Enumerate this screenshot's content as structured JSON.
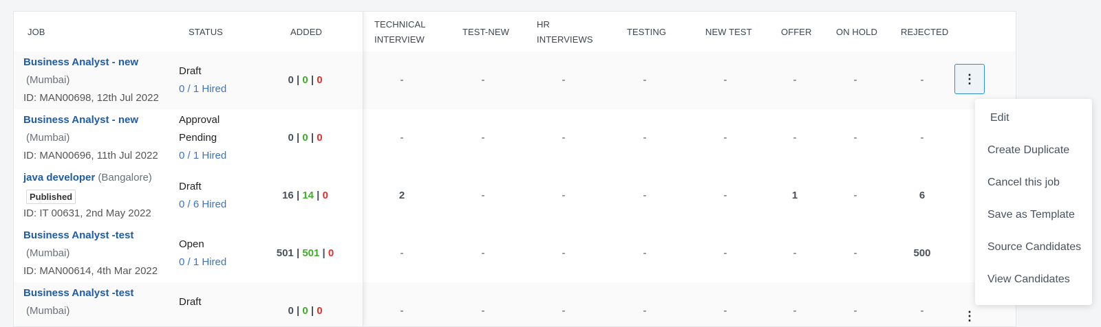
{
  "columns": [
    "Job",
    "Status",
    "Added",
    "Technical Interview",
    "Test-new",
    "HR Interviews",
    "Testing",
    "New Test",
    "Offer",
    "On Hold",
    "Rejected"
  ],
  "rows": [
    {
      "title": "Business Analyst - new",
      "location": "(Mumbai)",
      "id": "ID: MAN00698, 12th Jul 2022",
      "status": "Draft",
      "hired": "0 / 1 Hired",
      "added": {
        "a": "0",
        "b": "0",
        "c": "0"
      },
      "stages": [
        "-",
        "-",
        "-",
        "-",
        "-",
        "-",
        "-",
        "-"
      ]
    },
    {
      "title": "Business Analyst - new",
      "location": "(Mumbai)",
      "id": "ID: MAN00696, 11th Jul 2022",
      "status_line1": "Approval",
      "status_line2": "Pending",
      "hired": "0 / 1 Hired",
      "added": {
        "a": "0",
        "b": "0",
        "c": "0"
      },
      "stages": [
        "-",
        "-",
        "-",
        "-",
        "-",
        "-",
        "-",
        "-"
      ]
    },
    {
      "title": "java developer",
      "location": "(Bangalore)",
      "badge": "Published",
      "id": "ID: IT 00631, 2nd May 2022",
      "status": "Draft",
      "hired": "0 / 6 Hired",
      "added": {
        "a": "16",
        "b": "14",
        "c": "0"
      },
      "stages": [
        "2",
        "-",
        "-",
        "-",
        "-",
        "1",
        "-",
        "6"
      ]
    },
    {
      "title": "Business Analyst -test",
      "location": "(Mumbai)",
      "id": "ID: MAN00614, 4th Mar 2022",
      "status": "Open",
      "hired": "0 / 1 Hired",
      "added": {
        "a": "501",
        "b": "501",
        "c": "0"
      },
      "stages": [
        "-",
        "-",
        "-",
        "-",
        "-",
        "-",
        "-",
        "500"
      ]
    },
    {
      "title": "Business Analyst -test",
      "location": "(Mumbai)",
      "status": "Draft",
      "added": {
        "a": "0",
        "b": "0",
        "c": "0"
      },
      "stages": [
        "-",
        "-",
        "-",
        "-",
        "-",
        "-",
        "-",
        "-"
      ]
    }
  ],
  "actions_menu": [
    "Edit",
    "Create Duplicate",
    "Cancel this job",
    "Save as Template",
    "Source Candidates",
    "View Candidates"
  ],
  "icons": {
    "row_actions": "more-vertical-icon"
  },
  "colors": {
    "link": "#1f5ba6",
    "hired": "#3a75c4",
    "green": "#3fae29",
    "red": "#e0302b",
    "focus": "#2a8fd0"
  }
}
